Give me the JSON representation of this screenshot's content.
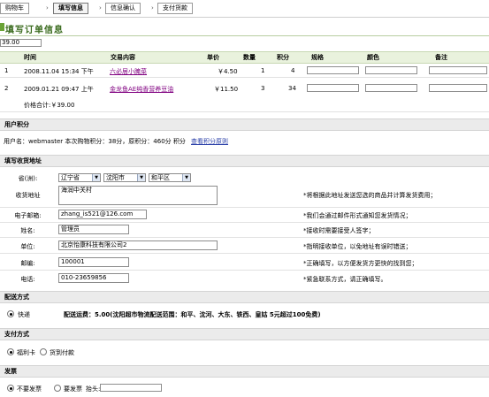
{
  "steps": [
    "购物车",
    "填写信息",
    "信息确认",
    "支付货款"
  ],
  "step_arrow": "›",
  "page_title": "填写订单信息",
  "total_top": "39.00",
  "table": {
    "headers": [
      "时间",
      "交易内容",
      "单价",
      "数量",
      "积分",
      "规格",
      "颜色",
      "备注"
    ],
    "rows": [
      {
        "no": "1",
        "time": "2008.11.04 15:34 下午",
        "item": "六必居小腌菜",
        "price": "￥4.50",
        "qty": "1",
        "points": "4"
      },
      {
        "no": "2",
        "time": "2009.01.21 09:47 上午",
        "item": "金龙鱼AE纯香营养豆油",
        "price": "￥11.50",
        "qty": "3",
        "points": "34"
      }
    ],
    "total_label": "价格合计:￥39.00"
  },
  "points_section": {
    "title": "用户积分",
    "text": "用户名：webmaster  本次购物积分：38分，原积分：460分  积分",
    "link": "查看积分原则"
  },
  "address_section": {
    "title": "填写收货地址",
    "province_label": "省(洲):",
    "province": "辽宁省",
    "city": "沈阳市",
    "district": "和平区",
    "address_label": "收货地址",
    "address_value": "海润中关村",
    "address_note": "*将根据此地址发送您选的商品并计算发货费用；",
    "email_label": "电子邮箱:",
    "email_value": "zhang_is521@126.com",
    "email_note": "*我们会通过邮件形式通知您发货情况；",
    "name_label": "姓名:",
    "name_value": "管理员",
    "name_note": "*接收时需要接受人签字；",
    "unit_label": "单位:",
    "unit_value": "北京怡康科技有限公司2",
    "unit_note": "*指明接收单位，以免地址有误时错送；",
    "zip_label": "邮编:",
    "zip_value": "100001",
    "zip_note": "*正确填写，以方便发货方更快的找到您；",
    "phone_label": "电话:",
    "phone_value": "010-23659856",
    "phone_note": "*紧急联系方式，请正确填写。"
  },
  "shipping_section": {
    "title": "配送方式",
    "option": "快递",
    "desc": "配送运费：5.00(沈阳超市物流配送范围：和平、沈河、大东、铁西、皇姑  5元超过100免费)"
  },
  "payment_section": {
    "title": "支付方式",
    "options": [
      "福利卡",
      "货到付款"
    ]
  },
  "invoice_section": {
    "title": "发票",
    "options": [
      "不要发票",
      "要发票"
    ],
    "header_label": "抬头:"
  }
}
